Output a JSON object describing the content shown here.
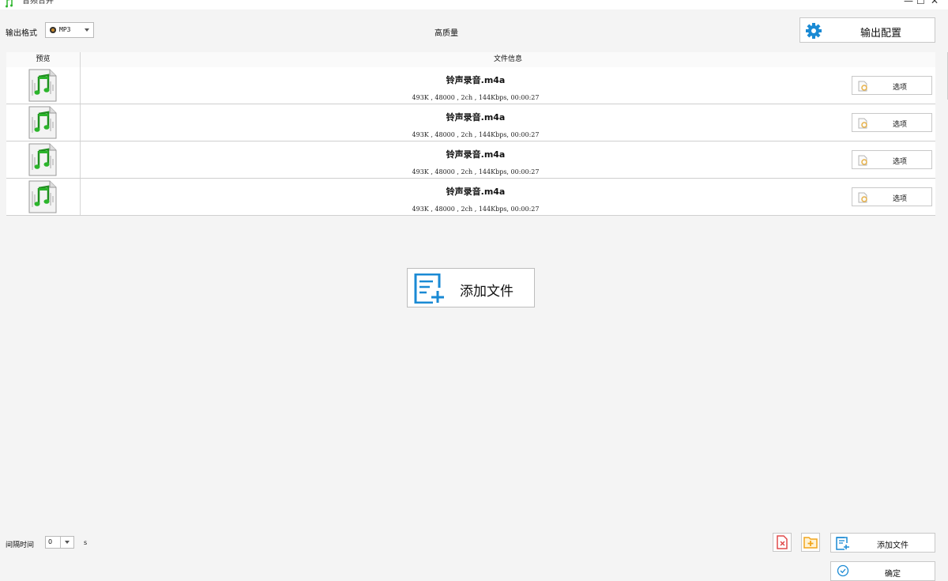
{
  "window": {
    "title": "音频合并",
    "controls": [
      "—",
      "☐",
      "✕"
    ]
  },
  "toolbar": {
    "format_label": "输出格式",
    "format_value": "MP3",
    "quality": "高质量",
    "output_config_label": "输出配置"
  },
  "table": {
    "columns": [
      "预览",
      "文件信息"
    ],
    "rows": [
      {
        "name": "铃声录音.m4a",
        "meta": "493K , 48000 , 2ch , 144Kbps, 00:00:27",
        "option_label": "选项"
      },
      {
        "name": "铃声录音.m4a",
        "meta": "493K , 48000 , 2ch , 144Kbps, 00:00:27",
        "option_label": "选项"
      },
      {
        "name": "铃声录音.m4a",
        "meta": "493K , 48000 , 2ch , 144Kbps, 00:00:27",
        "option_label": "选项"
      },
      {
        "name": "铃声录音.m4a",
        "meta": "493K , 48000 , 2ch , 144Kbps, 00:00:27",
        "option_label": "选项"
      }
    ]
  },
  "center": {
    "add_files_label": "添加文件"
  },
  "footer": {
    "interval_label": "间隔时间",
    "interval_value": "0",
    "interval_unit": "s",
    "add_files_label": "添加文件",
    "confirm_label": "确定"
  },
  "icons": {
    "app": "music-file-icon",
    "gear": "gear-icon",
    "thumb": "music-file-icon",
    "option": "settings-doc-icon",
    "add_file": "add-file-icon",
    "delete": "delete-file-icon",
    "add_folder": "add-folder-icon",
    "confirm": "check-circle-icon"
  },
  "colors": {
    "accent": "#1a8ad4",
    "music_green": "#2bb52b",
    "delete_red": "#e04a4a",
    "folder_orange": "#f2a51a"
  }
}
